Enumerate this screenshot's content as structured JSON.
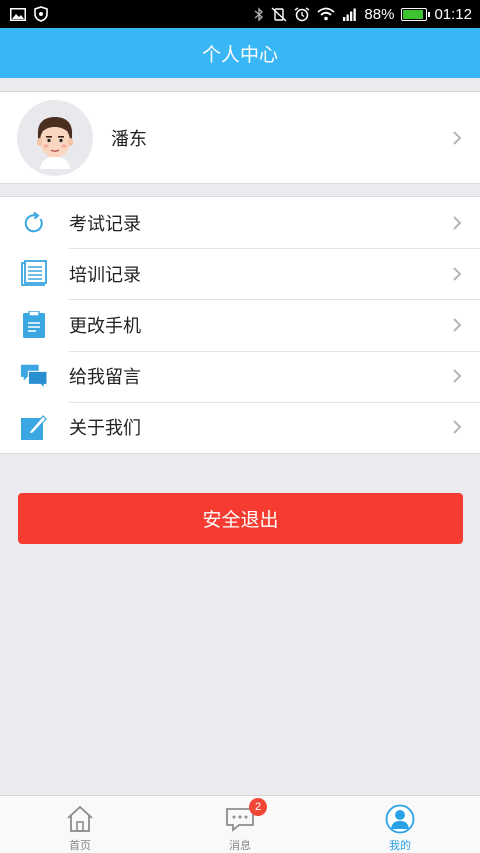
{
  "status_bar": {
    "battery_percent": "88%",
    "time": "01:12",
    "icons": [
      "image-icon",
      "shield-icon",
      "bluetooth-icon",
      "vibrate-off-icon",
      "alarm-icon",
      "wifi-icon",
      "signal-icon",
      "battery-icon"
    ],
    "battery_level": 0.88,
    "battery_color": "#3ec22f"
  },
  "header": {
    "title": "个人中心",
    "color": "#38b6f5"
  },
  "profile": {
    "name": "潘东",
    "avatar_icon": "avatar-icon"
  },
  "menu": {
    "items": [
      {
        "label": "考试记录",
        "icon": "refresh-icon"
      },
      {
        "label": "培训记录",
        "icon": "document-list-icon"
      },
      {
        "label": "更改手机",
        "icon": "clipboard-icon"
      },
      {
        "label": "给我留言",
        "icon": "chat-bubbles-icon"
      },
      {
        "label": "关于我们",
        "icon": "edit-icon"
      }
    ]
  },
  "logout": {
    "label": "安全退出",
    "color": "#f63b30"
  },
  "tab_bar": {
    "tabs": [
      {
        "label": "首页",
        "icon": "home-icon",
        "active": false
      },
      {
        "label": "消息",
        "icon": "message-icon",
        "active": false,
        "badge": "2"
      },
      {
        "label": "我的",
        "icon": "user-icon",
        "active": true
      }
    ],
    "active_color": "#2aa2e6"
  }
}
